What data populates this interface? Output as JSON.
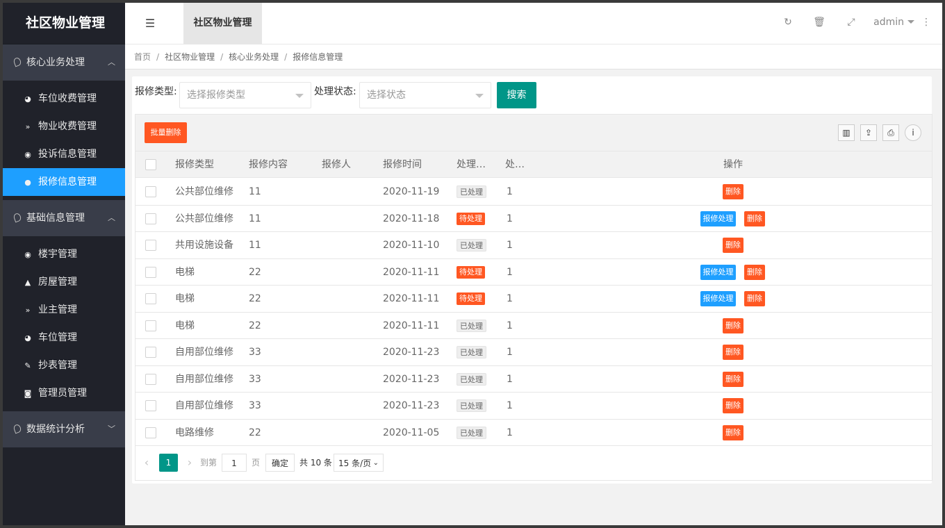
{
  "sidebar": {
    "logo": "社区物业管理",
    "groups": [
      {
        "label": "核心业务处理",
        "arrow": "^",
        "items": [
          {
            "label": "车位收费管理",
            "icon": "dashboard-icon"
          },
          {
            "label": "物业收费管理",
            "icon": "double-chevron-icon"
          },
          {
            "label": "投诉信息管理",
            "icon": "target-icon"
          },
          {
            "label": "报修信息管理",
            "icon": "circle-icon"
          }
        ]
      },
      {
        "label": "基础信息管理",
        "arrow": "^",
        "items": [
          {
            "label": "楼宇管理",
            "icon": "target-icon"
          },
          {
            "label": "房屋管理",
            "icon": "navigation-icon"
          },
          {
            "label": "业主管理",
            "icon": "double-chevron-icon"
          },
          {
            "label": "车位管理",
            "icon": "dashboard-icon"
          },
          {
            "label": "抄表管理",
            "icon": "edit-icon"
          },
          {
            "label": "管理员管理",
            "icon": "user-circle-icon"
          }
        ]
      },
      {
        "label": "数据统计分析",
        "arrow": "v",
        "items": []
      }
    ]
  },
  "header": {
    "tab": "社区物业管理",
    "user": "admin"
  },
  "breadcrumb": [
    "首页",
    "社区物业管理",
    "核心业务处理",
    "报修信息管理"
  ],
  "search": {
    "type_label": "报修类型:",
    "type_placeholder": "选择报修类型",
    "status_label": "处理状态:",
    "status_placeholder": "选择状态",
    "button": "搜索"
  },
  "toolbar": {
    "batch_delete": "批量删除"
  },
  "table": {
    "columns": [
      "报修类型",
      "报修内容",
      "报修人",
      "报修时间",
      "处理…",
      "处…",
      "操作"
    ],
    "rows": [
      {
        "type": "公共部位维修",
        "content": "11",
        "reporter": "",
        "time": "2020-11-19",
        "status": "已处理",
        "handled": "1"
      },
      {
        "type": "公共部位维修",
        "content": "11",
        "reporter": "",
        "time": "2020-11-18",
        "status": "待处理",
        "handled": "1"
      },
      {
        "type": "共用设施设备",
        "content": "11",
        "reporter": "",
        "time": "2020-11-10",
        "status": "已处理",
        "handled": "1"
      },
      {
        "type": "电梯",
        "content": "22",
        "reporter": "",
        "time": "2020-11-11",
        "status": "待处理",
        "handled": "1"
      },
      {
        "type": "电梯",
        "content": "22",
        "reporter": "",
        "time": "2020-11-11",
        "status": "待处理",
        "handled": "1"
      },
      {
        "type": "电梯",
        "content": "22",
        "reporter": "",
        "time": "2020-11-11",
        "status": "已处理",
        "handled": "1"
      },
      {
        "type": "自用部位维修",
        "content": "33",
        "reporter": "",
        "time": "2020-11-23",
        "status": "已处理",
        "handled": "1"
      },
      {
        "type": "自用部位维修",
        "content": "33",
        "reporter": "",
        "time": "2020-11-23",
        "status": "已处理",
        "handled": "1"
      },
      {
        "type": "自用部位维修",
        "content": "33",
        "reporter": "",
        "time": "2020-11-23",
        "status": "已处理",
        "handled": "1"
      },
      {
        "type": "电路维修",
        "content": "22",
        "reporter": "",
        "time": "2020-11-05",
        "status": "已处理",
        "handled": "1"
      }
    ],
    "actions": {
      "process": "报修处理",
      "delete": "删除"
    },
    "pending_status": "待处理"
  },
  "pager": {
    "current": "1",
    "goto_label": "到第",
    "goto_value": "1",
    "page_unit": "页",
    "confirm": "确定",
    "total": "共 10 条",
    "page_size": "15 条/页"
  }
}
